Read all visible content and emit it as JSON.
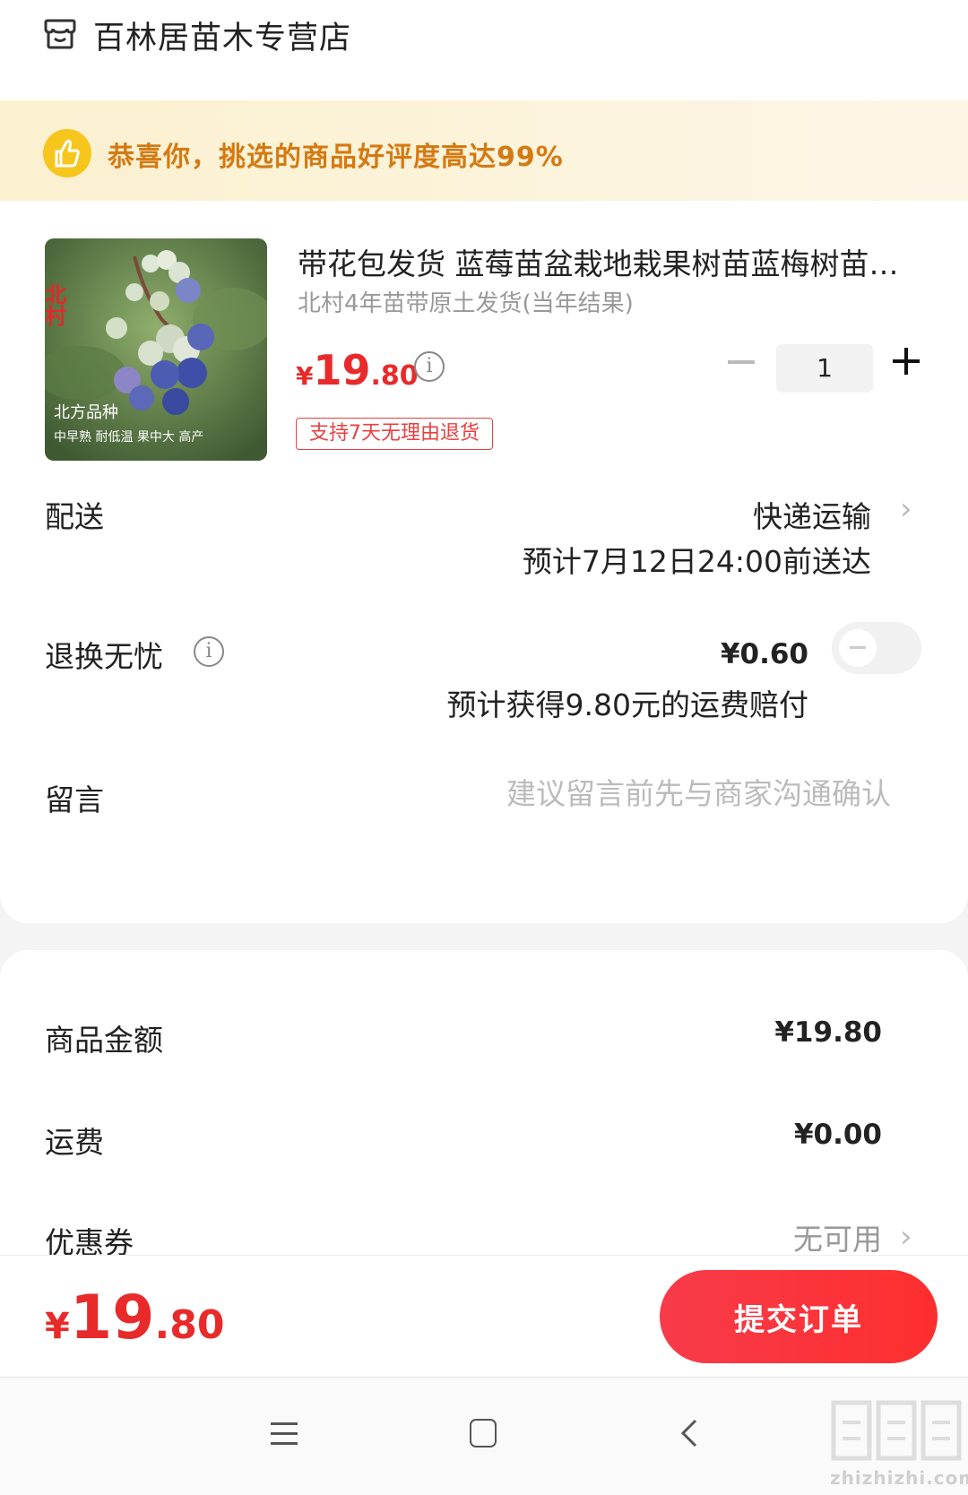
{
  "store": {
    "name": "百林居苗木专营店",
    "icon": "store-icon"
  },
  "banner": {
    "icon": "thumbs-up-icon",
    "text": "恭喜你，挑选的商品好评度高达99%"
  },
  "product": {
    "title": "带花包发货 蓝莓苗盆栽地栽果树苗蓝梅树苗南北方四季种植",
    "spec": "北村4年苗带原土发货(当年结果)",
    "price": {
      "currency": "¥",
      "integer": "19",
      "decimal": ".80"
    },
    "image_text": {
      "brand": "北村",
      "line1": "北方品种",
      "line2": "中早熟 耐低温 果中大 高产"
    },
    "quantity": "1",
    "return_tag": "支持7天无理由退货"
  },
  "delivery": {
    "label": "配送",
    "method": "快递运输",
    "eta": "预计7月12日24:00前送达"
  },
  "return_insurance": {
    "label": "退换无忧",
    "price": "¥0.60",
    "desc": "预计获得9.80元的运费赔付",
    "enabled": false
  },
  "message": {
    "label": "留言",
    "placeholder": "建议留言前先与商家沟通确认",
    "value": ""
  },
  "summary": {
    "goods_label": "商品金额",
    "goods_value": "¥19.80",
    "shipping_label": "运费",
    "shipping_value": "¥0.00",
    "coupon_label": "优惠券",
    "coupon_value": "无可用"
  },
  "footer": {
    "total": {
      "currency": "¥",
      "integer": "19",
      "decimal": ".80"
    },
    "submit_label": "提交订单"
  },
  "watermark": "zhizhizhi.com",
  "colors": {
    "accent_red": "#e82a2a",
    "banner_orange": "#d47a13",
    "banner_bg": "#fbf0cf"
  }
}
